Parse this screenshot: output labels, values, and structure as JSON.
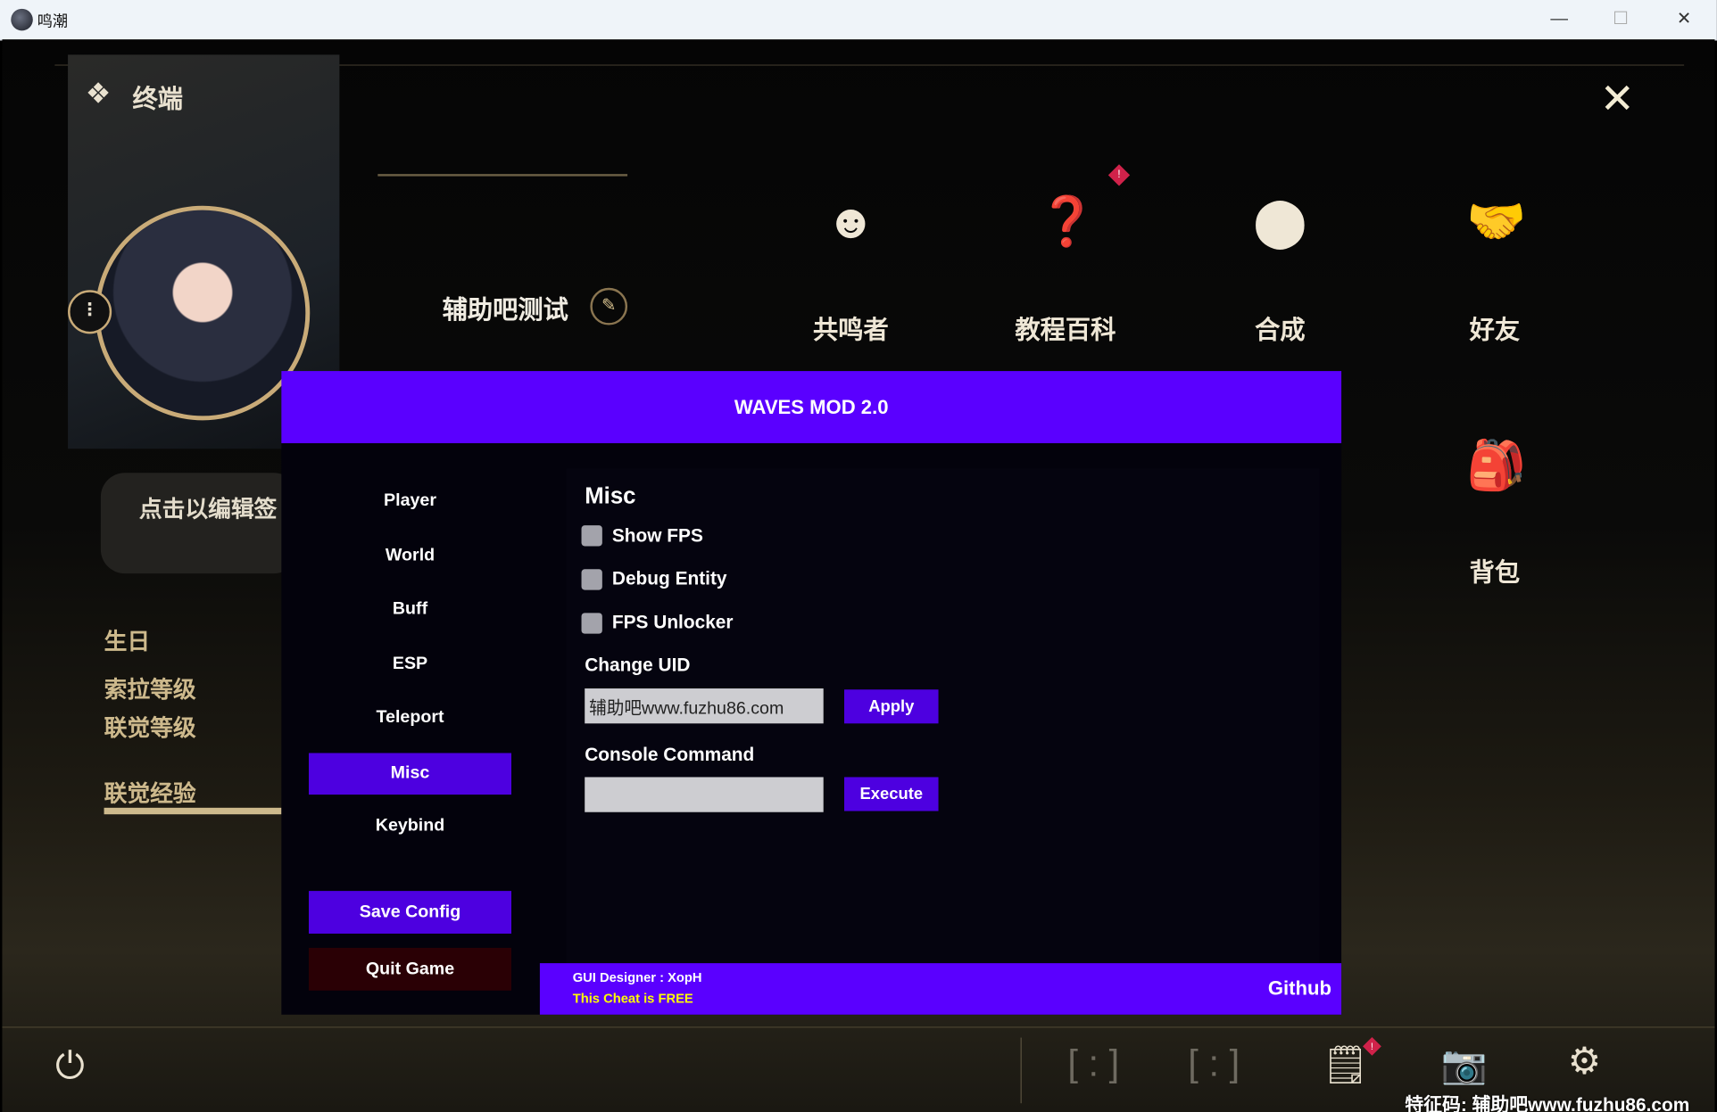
{
  "window": {
    "title": "鸣潮",
    "minimize": "—",
    "maximize": "☐",
    "close": "✕"
  },
  "game": {
    "section_title": "终端",
    "player_name": "辅助吧测试",
    "signature_hint": "点击以编辑签",
    "profile_fields": [
      "生日",
      "索拉等级",
      "联觉等级",
      "联觉经验"
    ],
    "menu": [
      {
        "label": "共鸣者",
        "icon": "resonator-icon"
      },
      {
        "label": "教程百科",
        "icon": "guidebook-icon",
        "badge": "!"
      },
      {
        "label": "合成",
        "icon": "synthesis-icon"
      },
      {
        "label": "好友",
        "icon": "friends-icon"
      },
      {
        "label": "背包",
        "icon": "backpack-icon"
      }
    ],
    "bottom": {
      "slot1": "[ : ]",
      "slot2": "[ : ]",
      "notice_badge": "!",
      "watermark": "特征码: 辅助吧www.fuzhu86.com"
    }
  },
  "mod": {
    "title": "WAVES MOD 2.0",
    "nav": [
      "Player",
      "World",
      "Buff",
      "ESP",
      "Teleport",
      "Misc",
      "Keybind"
    ],
    "active_nav": "Misc",
    "save_config": "Save Config",
    "quit_game": "Quit Game",
    "section": "Misc",
    "checkboxes": [
      {
        "label": "Show FPS",
        "checked": false
      },
      {
        "label": "Debug Entity",
        "checked": false
      },
      {
        "label": "FPS Unlocker",
        "checked": false
      }
    ],
    "change_uid": {
      "label": "Change UID",
      "value": "辅助吧www.fuzhu86.com",
      "button": "Apply"
    },
    "console": {
      "label": "Console Command",
      "value": "",
      "button": "Execute"
    },
    "footer": {
      "designer": "GUI Designer : XopH",
      "free": "This Cheat is FREE",
      "github": "Github"
    },
    "colors": {
      "accent": "#5a00ff",
      "button": "#4d00e0",
      "quit": "#2a0005",
      "free_text": "#ffff00"
    }
  }
}
